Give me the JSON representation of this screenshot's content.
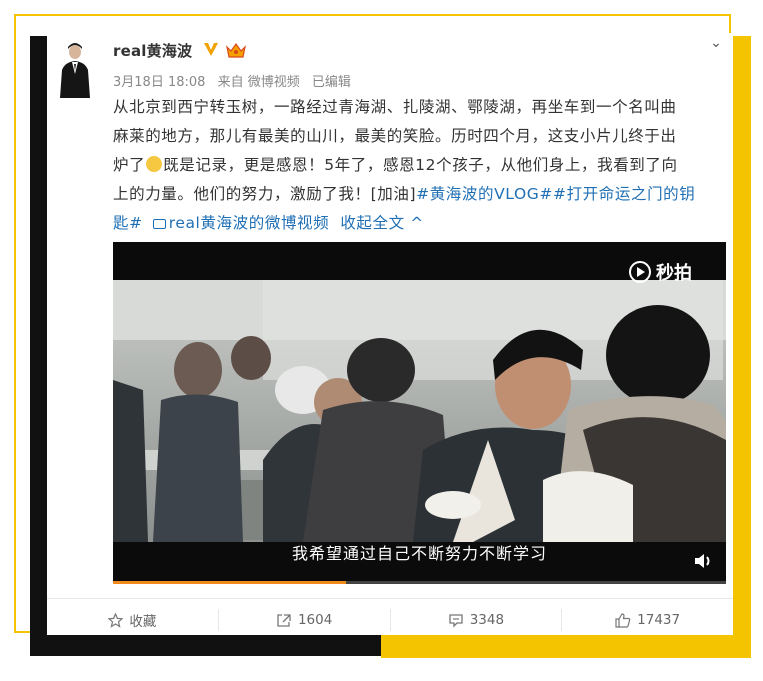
{
  "post": {
    "username": "real黄海波",
    "meta": {
      "date": "3月18日 18:08",
      "source": "来自 微博视频",
      "edited": "已编辑"
    },
    "text": {
      "line1": "从北京到西宁转玉树，一路经过青海湖、扎陵湖、鄂陵湖，再坐车到一个名叫曲",
      "line2": "麻莱的地方，那儿有最美的山川，最美的笑脸。历时四个月，这支小片儿终于出",
      "line3a": "炉了",
      "line3b": "既是记录，更是感恩！5年了，感恩12个孩子，从他们身上，我看到了向",
      "line4a": "上的力量。他们的努力，激励了我！[加油]",
      "line4b": "#黄海波的VLOG##打开命运之门的钥",
      "line5a": "匙#",
      "video_link": "real黄海波的微博视频",
      "collapse_link": "收起全文 ^"
    },
    "video": {
      "watermark": "秒拍",
      "subtitle": "我希望通过自己不断努力不断学习",
      "progress": 0.38
    }
  },
  "actions": {
    "favorite_label": "收藏",
    "repost_count": "1604",
    "comment_count": "3348",
    "like_count": "17437"
  },
  "colors": {
    "link": "#1f6fb5",
    "frame_yellow": "#f4c400",
    "vip_orange": "#f2a100"
  },
  "icons": {
    "favorite": "star-icon",
    "repost": "share-arrow-icon",
    "comment": "speech-bubble-icon",
    "like": "thumbs-up-icon",
    "collapse": "chevron-down-icon",
    "volume": "speaker-icon"
  }
}
